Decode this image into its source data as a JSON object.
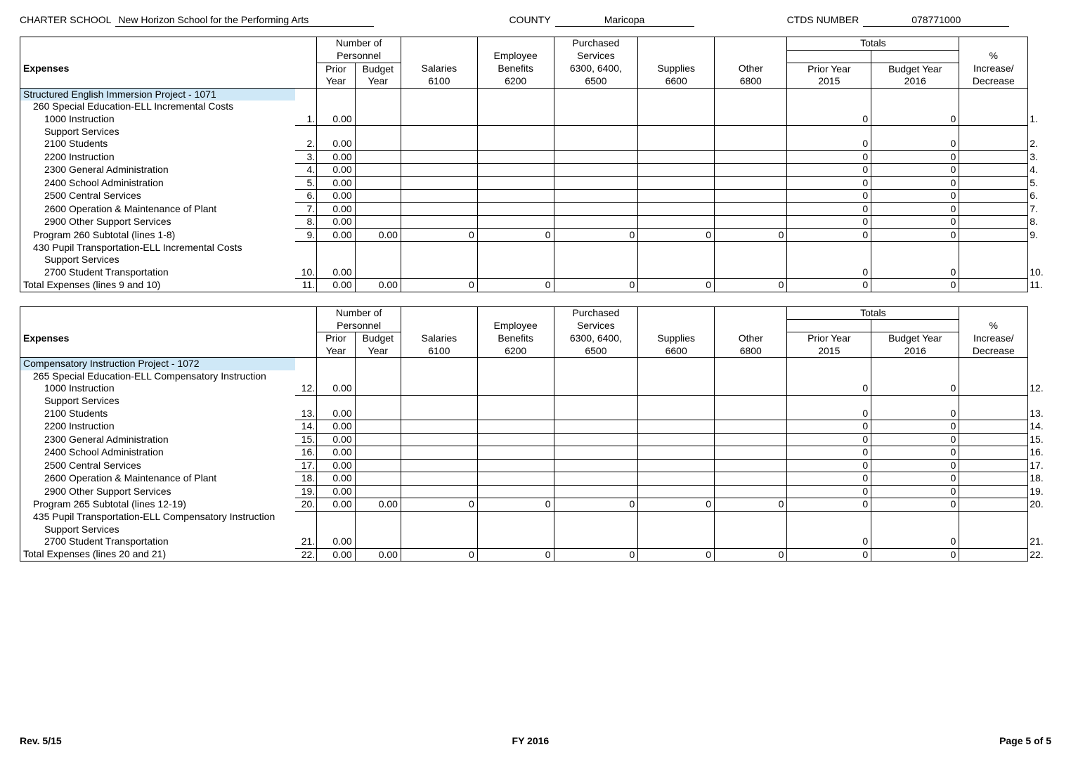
{
  "header": {
    "school_lbl": "CHARTER SCHOOL",
    "school": "New Horizon School for the Performing Arts",
    "county_lbl": "COUNTY",
    "county": "Maricopa",
    "ctds_lbl": "CTDS NUMBER",
    "ctds": "078771000"
  },
  "cols": {
    "expenses": "Expenses",
    "num_pers1": "Number of",
    "num_pers2": "Personnel",
    "prior": "Prior",
    "year": "Year",
    "budget": "Budget",
    "salaries1": "Salaries",
    "salaries2": "6100",
    "benefits1": "Employee",
    "benefits2": "Benefits",
    "benefits3": "6200",
    "purch1": "Purchased",
    "purch2": "Services",
    "purch3": "6300, 6400,",
    "purch4": "6500",
    "supplies1": "Supplies",
    "supplies2": "6600",
    "other1": "Other",
    "other2": "6800",
    "totals": "Totals",
    "tpy1": "Prior Year",
    "tpy2": "2015",
    "tby1": "Budget Year",
    "tby2": "2016",
    "pct1": "%",
    "pct2": "Increase/",
    "pct3": "Decrease"
  },
  "t1": {
    "project": "Structured English Immersion Project - 1071",
    "sec260": "260 Special Education-ELL Incremental Costs",
    "support": "Support Services",
    "rows": [
      {
        "label": "1000 Instruction",
        "n": "1.",
        "py": "0.00",
        "tpy": "0",
        "tby": "0",
        "out": "1."
      },
      {
        "label": "2100 Students",
        "n": "2.",
        "py": "0.00",
        "tpy": "0",
        "tby": "0",
        "out": "2."
      },
      {
        "label": "2200 Instruction",
        "n": "3.",
        "py": "0.00",
        "tpy": "0",
        "tby": "0",
        "out": "3."
      },
      {
        "label": "2300 General Administration",
        "n": "4.",
        "py": "0.00",
        "tpy": "0",
        "tby": "0",
        "out": "4."
      },
      {
        "label": "2400 School Administration",
        "n": "5.",
        "py": "0.00",
        "tpy": "0",
        "tby": "0",
        "out": "5."
      },
      {
        "label": "2500 Central Services",
        "n": "6.",
        "py": "0.00",
        "tpy": "0",
        "tby": "0",
        "out": "6."
      },
      {
        "label": "2600 Operation & Maintenance of Plant",
        "n": "7.",
        "py": "0.00",
        "tpy": "0",
        "tby": "0",
        "out": "7."
      },
      {
        "label": "2900 Other Support Services",
        "n": "8.",
        "py": "0.00",
        "tpy": "0",
        "tby": "0",
        "out": "8."
      }
    ],
    "sub": {
      "label": "Program 260 Subtotal (lines 1-8)",
      "n": "9.",
      "py": "0.00",
      "by": "0.00",
      "sal": "0",
      "ben": "0",
      "pur": "0",
      "sup": "0",
      "oth": "0",
      "tpy": "0",
      "tby": "0",
      "out": "9."
    },
    "sec430": "430 Pupil Transportation-ELL Incremental Costs",
    "r10": {
      "label": "2700 Student Transportation",
      "n": "10.",
      "py": "0.00",
      "tpy": "0",
      "tby": "0",
      "out": "10."
    },
    "tot": {
      "label": "Total Expenses (lines 9 and 10)",
      "n": "11.",
      "py": "0.00",
      "by": "0.00",
      "sal": "0",
      "ben": "0",
      "pur": "0",
      "sup": "0",
      "oth": "0",
      "tpy": "0",
      "tby": "0",
      "out": "11."
    }
  },
  "t2": {
    "project": "Compensatory Instruction Project - 1072",
    "sec265": "265 Special Education-ELL Compensatory Instruction",
    "support": "Support Services",
    "rows": [
      {
        "label": "1000 Instruction",
        "n": "12.",
        "py": "0.00",
        "tpy": "0",
        "tby": "0",
        "out": "12."
      },
      {
        "label": "2100 Students",
        "n": "13.",
        "py": "0.00",
        "tpy": "0",
        "tby": "0",
        "out": "13."
      },
      {
        "label": "2200 Instruction",
        "n": "14.",
        "py": "0.00",
        "tpy": "0",
        "tby": "0",
        "out": "14."
      },
      {
        "label": "2300 General Administration",
        "n": "15.",
        "py": "0.00",
        "tpy": "0",
        "tby": "0",
        "out": "15."
      },
      {
        "label": "2400 School Administration",
        "n": "16.",
        "py": "0.00",
        "tpy": "0",
        "tby": "0",
        "out": "16."
      },
      {
        "label": "2500 Central Services",
        "n": "17.",
        "py": "0.00",
        "tpy": "0",
        "tby": "0",
        "out": "17."
      },
      {
        "label": "2600 Operation & Maintenance of Plant",
        "n": "18.",
        "py": "0.00",
        "tpy": "0",
        "tby": "0",
        "out": "18."
      },
      {
        "label": "2900 Other Support Services",
        "n": "19.",
        "py": "0.00",
        "tpy": "0",
        "tby": "0",
        "out": "19."
      }
    ],
    "sub": {
      "label": "Program 265 Subtotal (lines 12-19)",
      "n": "20.",
      "py": "0.00",
      "by": "0.00",
      "sal": "0",
      "ben": "0",
      "pur": "0",
      "sup": "0",
      "oth": "0",
      "tpy": "0",
      "tby": "0",
      "out": "20."
    },
    "sec435": "435 Pupil Transportation-ELL Compensatory Instruction",
    "r21": {
      "label": "2700 Student Transportation",
      "n": "21.",
      "py": "0.00",
      "tpy": "0",
      "tby": "0",
      "out": "21."
    },
    "tot": {
      "label": "Total Expenses (lines 20 and 21)",
      "n": "22.",
      "py": "0.00",
      "by": "0.00",
      "sal": "0",
      "ben": "0",
      "pur": "0",
      "sup": "0",
      "oth": "0",
      "tpy": "0",
      "tby": "0",
      "out": "22."
    }
  },
  "footer": {
    "rev": "Rev. 5/15",
    "fy": "FY 2016",
    "page": "Page 5 of 5"
  }
}
